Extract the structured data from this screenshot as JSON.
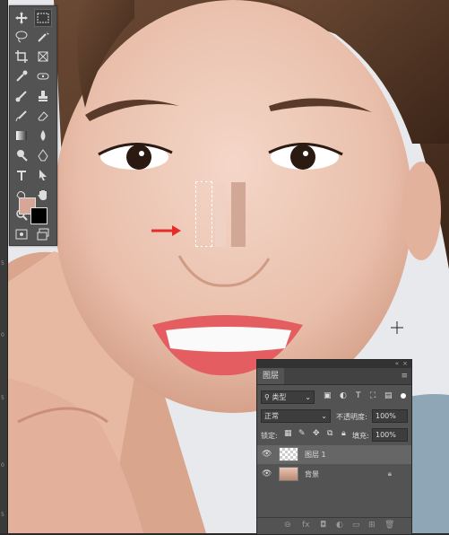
{
  "canvas": {
    "photo_desc": ""
  },
  "ruler": {
    "marks": [
      "5",
      "0",
      "5",
      "0",
      "5"
    ]
  },
  "toolbar": {
    "tools": [
      "move-icon",
      "marquee-icon",
      "lasso-icon",
      "magic-wand-icon",
      "crop-icon",
      "frame-icon",
      "eyedropper-icon",
      "spot-heal-icon",
      "brush-icon",
      "clone-stamp-icon",
      "history-brush-icon",
      "eraser-icon",
      "gradient-icon",
      "blur-icon",
      "dodge-icon",
      "pen-icon",
      "type-icon",
      "path-select-icon",
      "shape-icon",
      "hand-icon",
      "zoom-icon",
      "more-icon"
    ],
    "foreground_color": "#d6a797",
    "background_color": "#000000"
  },
  "swatches": {
    "light": "#efd2c4",
    "mid": "#d1a796"
  },
  "layers_panel": {
    "title": "图层",
    "filter_kind": "类型",
    "blend_mode": "正常",
    "opacity_label": "不透明度:",
    "opacity_value": "100%",
    "lock_label": "锁定:",
    "fill_label": "填充:",
    "fill_value": "100%",
    "layers": [
      {
        "name": "图层 1"
      },
      {
        "name": "背景"
      }
    ]
  }
}
